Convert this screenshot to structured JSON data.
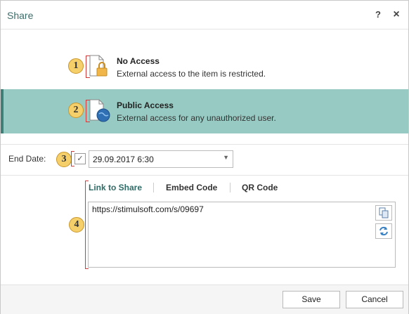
{
  "dialog": {
    "title": "Share"
  },
  "titlebar": {
    "help_label": "?",
    "close_label": "×"
  },
  "options": [
    {
      "title": "No Access",
      "description": "External access to the item is restricted.",
      "callout": "1",
      "icon": "lock-document-icon"
    },
    {
      "title": "Public Access",
      "description": "External access for any unauthorized user.",
      "callout": "2",
      "icon": "globe-document-icon"
    }
  ],
  "end_date": {
    "label": "End Date:",
    "value": "29.09.2017 6:30",
    "callout": "3",
    "checked": true
  },
  "tabs": [
    {
      "label": "Link to Share"
    },
    {
      "label": "Embed Code"
    },
    {
      "label": "QR Code"
    }
  ],
  "link": {
    "url": "https://stimulsoft.com/s/09697",
    "callout": "4"
  },
  "footer": {
    "save_label": "Save",
    "cancel_label": "Cancel"
  },
  "colors": {
    "selected_bg": "#97cac2",
    "accent": "#3f7f78",
    "callout": "#f5cf6a",
    "marker": "#d23a3a"
  }
}
